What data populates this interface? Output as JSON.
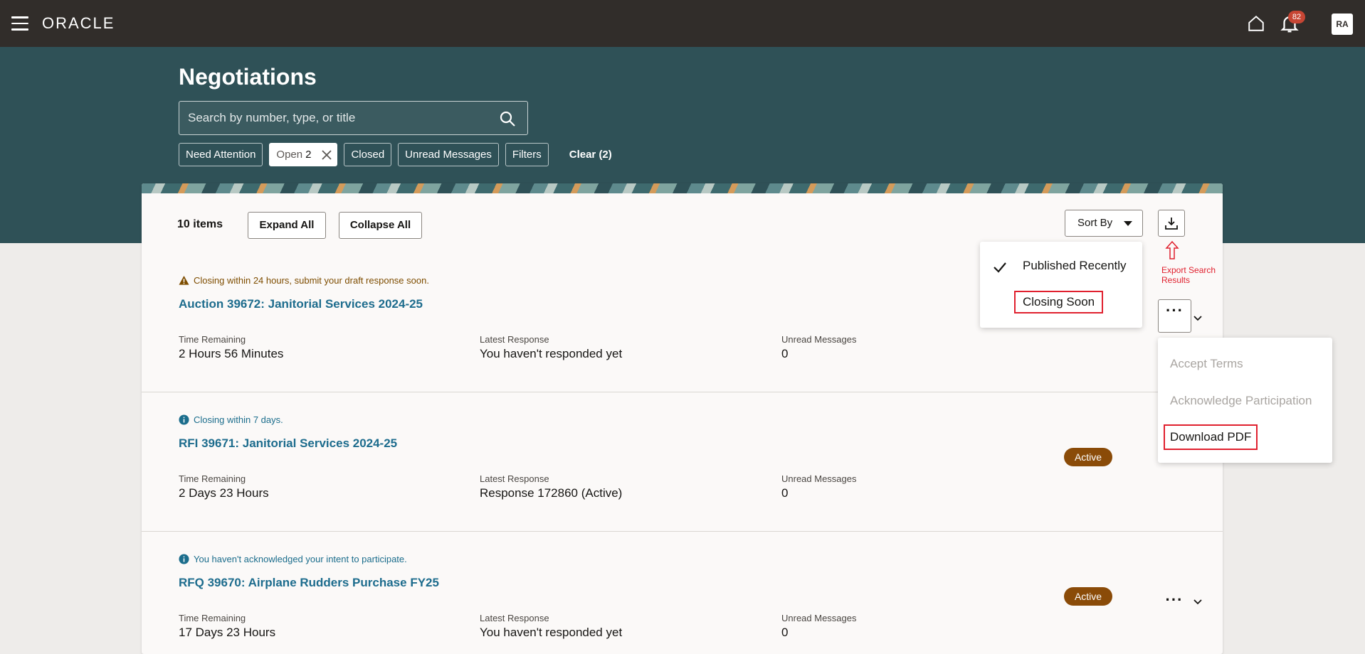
{
  "app": {
    "brand": "ORACLE"
  },
  "topbar": {
    "notifications_count": "82",
    "avatar_initials": "RA"
  },
  "page": {
    "title": "Negotiations"
  },
  "search": {
    "placeholder": "Search by number, type, or title"
  },
  "filters": {
    "need_attention": "Need Attention",
    "open_label": "Open",
    "open_count": "2",
    "closed": "Closed",
    "unread": "Unread Messages",
    "filters": "Filters",
    "clear": "Clear (2)"
  },
  "toolbar": {
    "items_count": "10 items",
    "expand_all": "Expand All",
    "collapse_all": "Collapse All",
    "sort_by": "Sort By"
  },
  "annotation": {
    "export_text": "Export Search Results"
  },
  "sort_menu": {
    "items": [
      "Published Recently",
      "Closing Soon"
    ],
    "selected": "Published Recently"
  },
  "action_menu": {
    "items": [
      "Accept Terms",
      "Acknowledge Participation",
      "Download PDF"
    ]
  },
  "labels": {
    "time_remaining": "Time Remaining",
    "latest_response": "Latest Response",
    "unread_messages": "Unread Messages"
  },
  "negotiations": [
    {
      "notice": "Closing within 24 hours, submit your draft response soon.",
      "title": "Auction 39672: Janitorial Services 2024-25",
      "time_remaining": "2 Hours 56 Minutes",
      "latest_response": "You haven't responded yet",
      "unread_messages": "0",
      "status": ""
    },
    {
      "notice": "Closing within 7 days.",
      "title": "RFI 39671: Janitorial Services 2024-25",
      "time_remaining": "2 Days 23 Hours",
      "latest_response": "Response 172860 (Active)",
      "unread_messages": "0",
      "status": "Active"
    },
    {
      "notice": "You haven't acknowledged your intent to participate.",
      "title": "RFQ 39670: Airplane Rudders Purchase FY25",
      "time_remaining": "17 Days 23 Hours",
      "latest_response": "You haven't responded yet",
      "unread_messages": "0",
      "status": "Active"
    }
  ],
  "colors": {
    "topbar": "#312d2a",
    "header_band": "#2f5157",
    "link": "#1d6c8d",
    "badge": "#8a4b08",
    "annotation": "#e0202e"
  }
}
